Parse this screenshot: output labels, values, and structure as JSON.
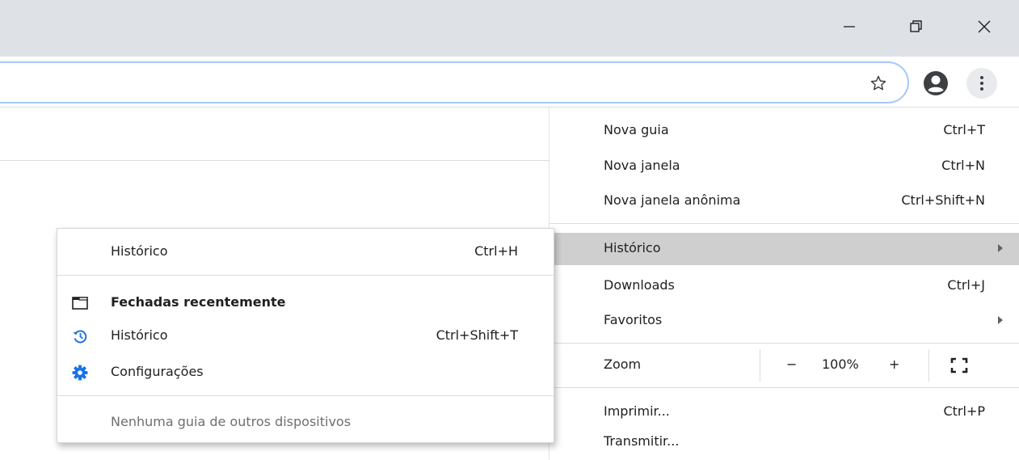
{
  "window": {
    "minimize_label": "—",
    "restore_label": "",
    "close_label": ""
  },
  "toolbar": {
    "bookmark_icon": "star-outline-icon",
    "profile_icon": "account-circle-icon",
    "menu_icon": "three-dots-vertical-icon"
  },
  "main_menu": {
    "items": [
      {
        "label": "Nova guia",
        "shortcut": "Ctrl+T"
      },
      {
        "label": "Nova janela",
        "shortcut": "Ctrl+N"
      },
      {
        "label": "Nova janela anônima",
        "shortcut": "Ctrl+Shift+N"
      },
      {
        "label": "Histórico",
        "shortcut": "",
        "submenu": true,
        "highlighted": true
      },
      {
        "label": "Downloads",
        "shortcut": "Ctrl+J"
      },
      {
        "label": "Favoritos",
        "shortcut": "",
        "submenu": true
      },
      {
        "label": "Imprimir...",
        "shortcut": "Ctrl+P"
      },
      {
        "label": "Transmitir...",
        "shortcut": ""
      }
    ],
    "zoom": {
      "label": "Zoom",
      "minus": "−",
      "value": "100%",
      "plus": "+",
      "fullscreen_icon": "fullscreen-icon"
    }
  },
  "history_submenu": {
    "history_item": {
      "label": "Histórico",
      "shortcut": "Ctrl+H"
    },
    "recently_closed_header": {
      "label": "Fechadas recentemente",
      "icon": "tab-window-icon"
    },
    "recent_history": {
      "label": "Histórico",
      "shortcut": "Ctrl+Shift+T",
      "icon": "history-restore-icon"
    },
    "recent_settings": {
      "label": "Configurações",
      "icon": "settings-gear-icon"
    },
    "no_devices": {
      "label": "Nenhuma guia de outros dispositivos"
    }
  },
  "colors": {
    "titlebar": "#dee1e6",
    "omnibox_border": "#a8c7fa",
    "highlight": "#cfcfcf",
    "accent_blue": "#1a73e8"
  }
}
